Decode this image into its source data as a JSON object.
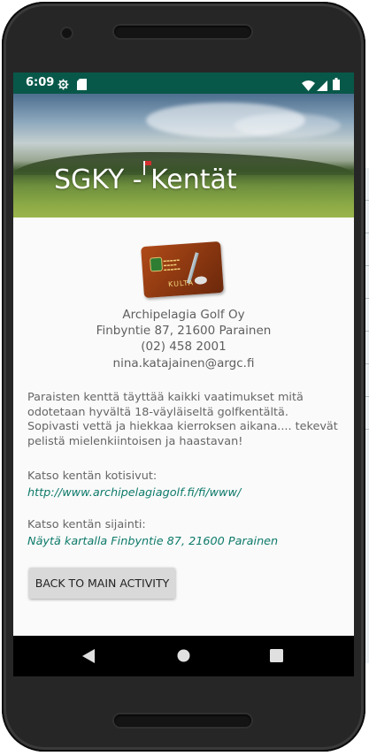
{
  "status_bar": {
    "time": "6:09",
    "icons": [
      "gear-icon",
      "sd-card-icon",
      "wifi-icon",
      "signal-icon",
      "battery-icon"
    ],
    "color": "#08584a"
  },
  "header": {
    "title": "SGKY - Kentät"
  },
  "club_card": {
    "label": "KULTA"
  },
  "contact": {
    "name": "Archipelagia Golf Oy",
    "address": "Finbyntie 87, 21600 Parainen",
    "phone": "(02) 458 2001",
    "email": "nina.katajainen@argc.fi"
  },
  "description": "Paraisten kenttä täyttää kaikki vaatimukset mitä odotetaan hyvältä 18-väyläiseltä golfkentältä. Sopivasti vettä ja hiekkaa kierroksen aikana.... tekevät pelistä mielenkiintoisen ja haastavan!",
  "website": {
    "label": "Katso kentän kotisivut:",
    "link": "http://www.archipelagiagolf.fi/fi/www/"
  },
  "location": {
    "label": "Katso kentän sijainti:",
    "link": "Näytä kartalla Finbyntie 87, 21600 Parainen"
  },
  "button": {
    "label": "BACK TO MAIN ACTIVITY"
  },
  "nav_bar": {
    "icons": [
      "back-icon",
      "home-icon",
      "recents-icon"
    ]
  },
  "colors": {
    "accent": "#0d7a6a",
    "button": "#d9d9d9",
    "text": "#666666"
  }
}
